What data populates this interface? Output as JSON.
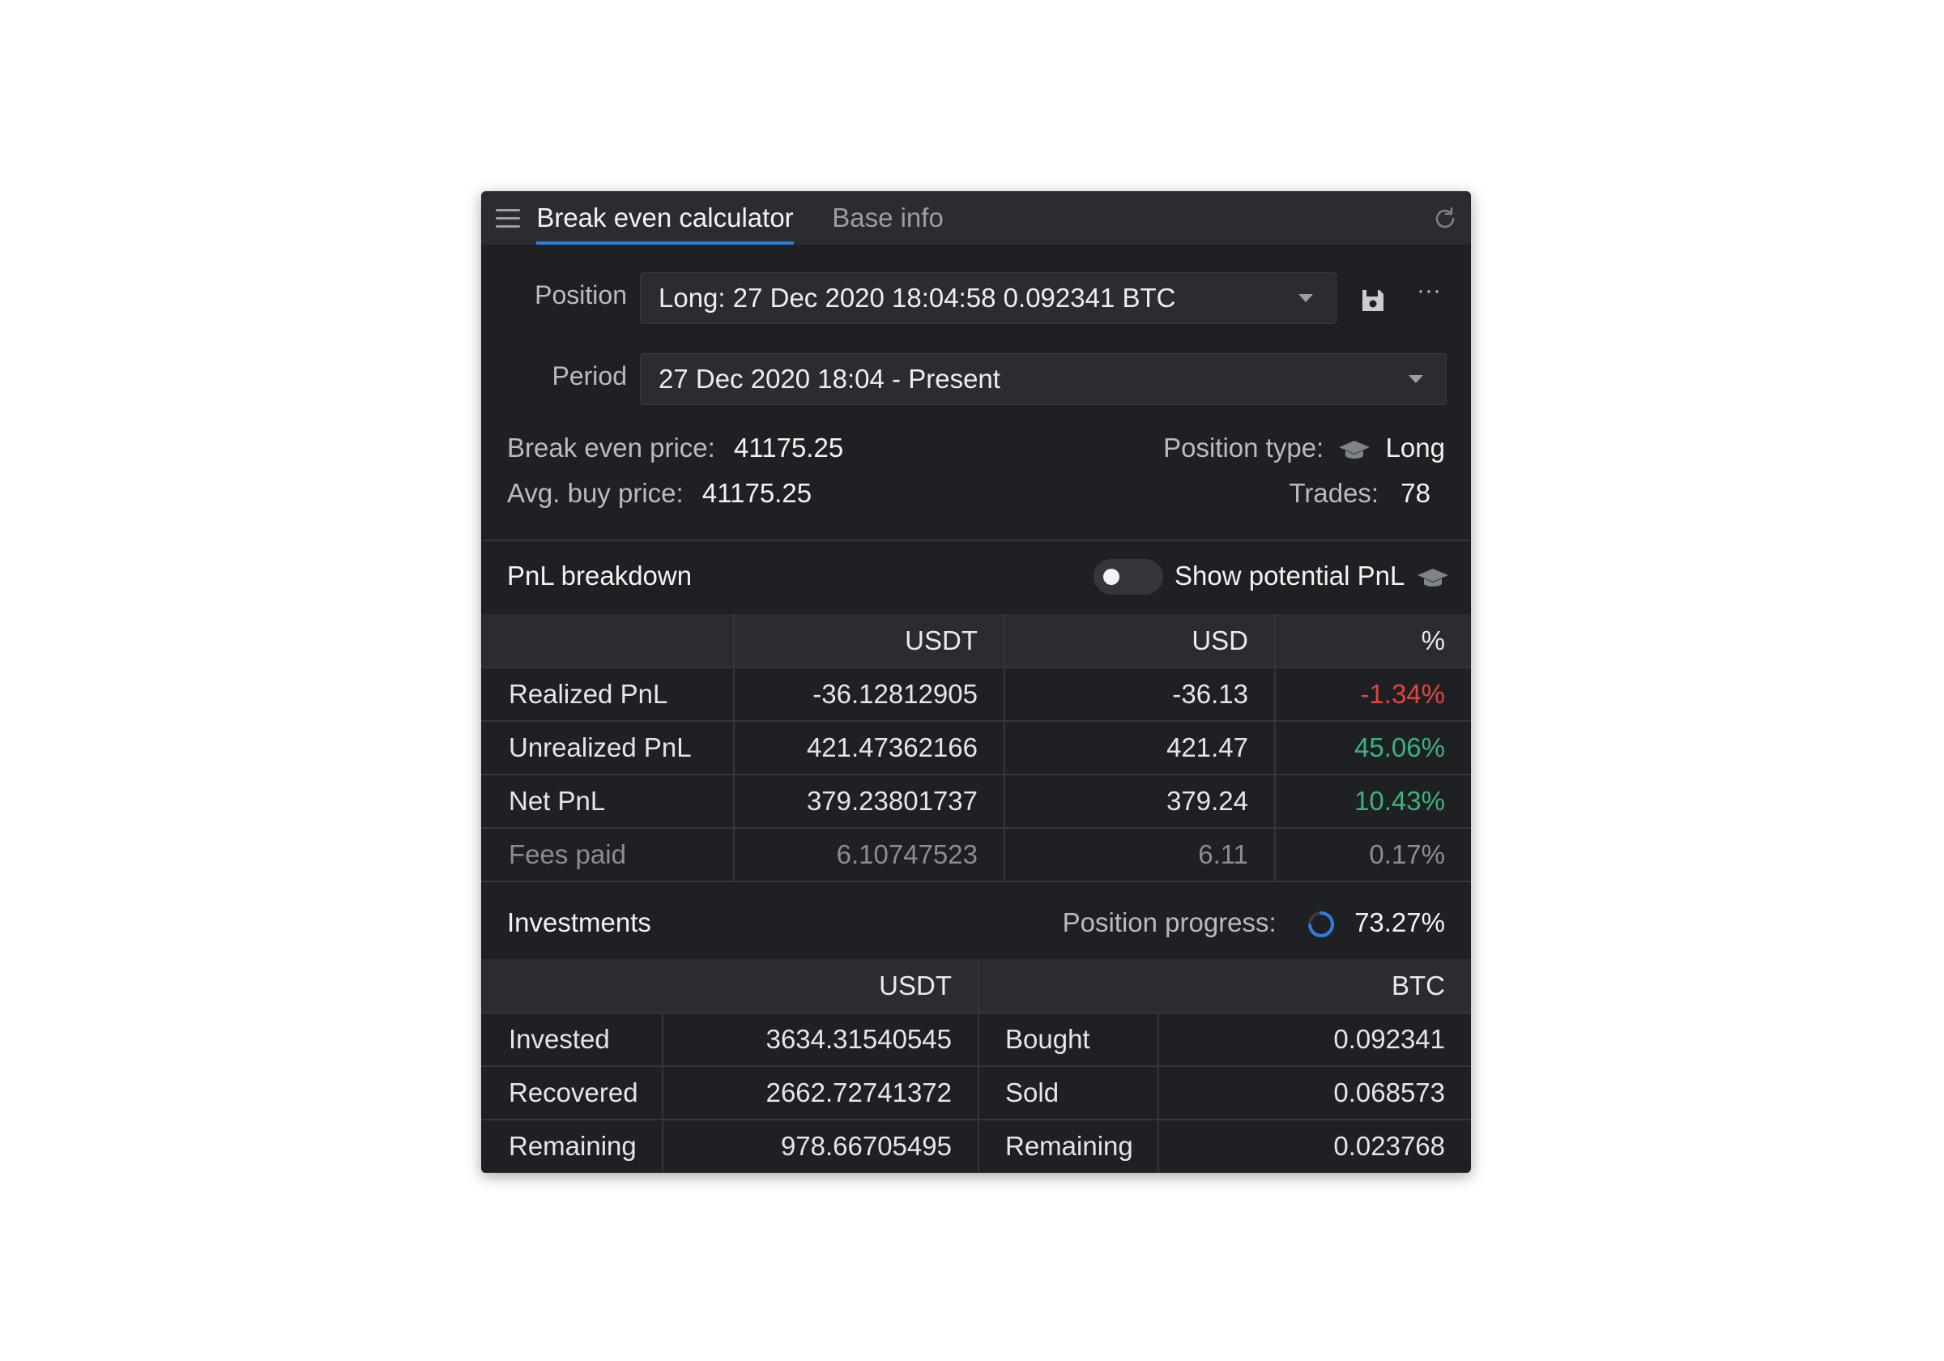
{
  "tabs": {
    "active": "Break even calculator",
    "inactive": "Base info"
  },
  "form": {
    "position_label": "Position",
    "position_value": "Long: 27 Dec 2020 18:04:58 0.092341 BTC",
    "period_label": "Period",
    "period_value": "27 Dec 2020 18:04 - Present",
    "more_label": "···"
  },
  "info": {
    "break_even_label": "Break even price:",
    "break_even_value": "41175.25",
    "avg_buy_label": "Avg. buy price:",
    "avg_buy_value": "41175.25",
    "position_type_label": "Position type:",
    "position_type_value": "Long",
    "trades_label": "Trades:",
    "trades_value": "78"
  },
  "pnl": {
    "title": "PnL breakdown",
    "toggle_label": "Show potential PnL",
    "toggle_on": false,
    "headers": [
      "",
      "USDT",
      "USD",
      "%"
    ],
    "rows": [
      {
        "label": "Realized PnL",
        "usdt": "-36.12812905",
        "usd": "-36.13",
        "pct": "-1.34%",
        "status": "negative"
      },
      {
        "label": "Unrealized PnL",
        "usdt": "421.47362166",
        "usd": "421.47",
        "pct": "45.06%",
        "status": "positive"
      },
      {
        "label": "Net PnL",
        "usdt": "379.23801737",
        "usd": "379.24",
        "pct": "10.43%",
        "status": "positive"
      },
      {
        "label": "Fees paid",
        "usdt": "6.10747523",
        "usd": "6.11",
        "pct": "0.17%",
        "status": "muted"
      }
    ]
  },
  "investments": {
    "title": "Investments",
    "progress_label": "Position progress:",
    "progress_value": "73.27%",
    "progress_fraction": 0.7327,
    "headers": [
      "USDT",
      "BTC"
    ],
    "rows": [
      {
        "label": "Invested",
        "usdt": "3634.31540545",
        "btc_label": "Bought",
        "btc": "0.092341"
      },
      {
        "label": "Recovered",
        "usdt": "2662.72741372",
        "btc_label": "Sold",
        "btc": "0.068573"
      },
      {
        "label": "Remaining",
        "usdt": "978.66705495",
        "btc_label": "Remaining",
        "btc": "0.023768"
      }
    ]
  },
  "colors": {
    "accent": "#2f7de1",
    "negative": "#e0463f",
    "positive": "#3bb37a",
    "panel": "#1f2023"
  },
  "icons": [
    "menu-icon",
    "refresh-icon",
    "chevron-down-icon",
    "save-icon",
    "more-icon",
    "graduation-cap-icon",
    "progress-ring-icon"
  ]
}
